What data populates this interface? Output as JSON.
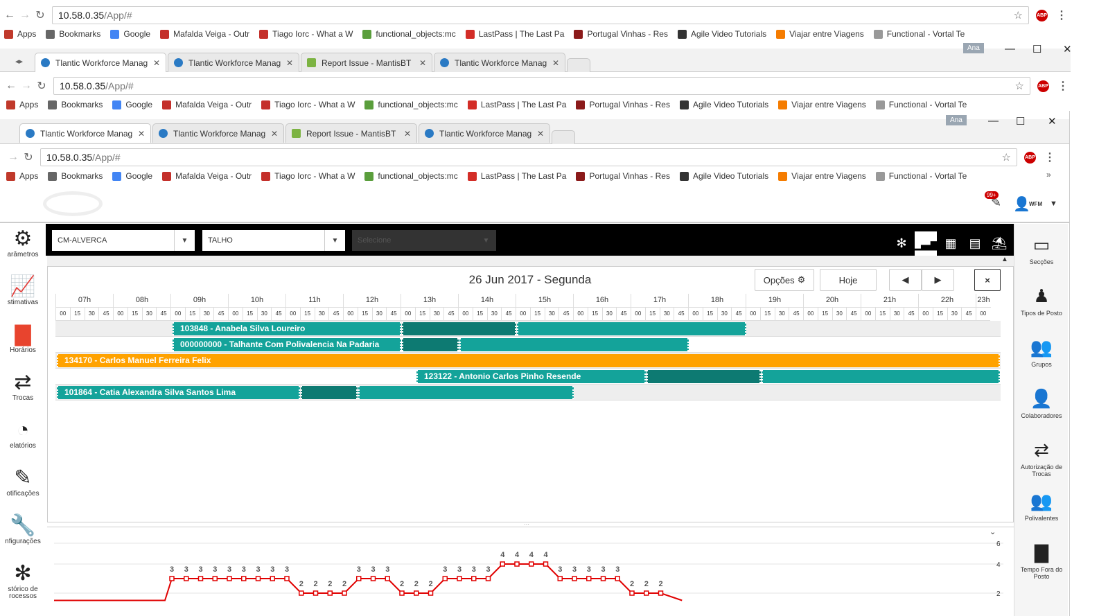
{
  "browser_back": {
    "url_host": "10.58.0.35",
    "url_path": "/App/#"
  },
  "browser_mid": {
    "url_host": "10.58.0.35",
    "url_path": "/App/#",
    "tabs": [
      "Tlantic Workforce Manag",
      "Tlantic Workforce Manag",
      "Report Issue - MantisBT",
      "Tlantic Workforce Manag"
    ],
    "user": "Ana"
  },
  "browser_front": {
    "url_host": "10.58.0.35",
    "url_path": "/App/#",
    "tabs": [
      "Tlantic Workforce Manag",
      "Tlantic Workforce Manag",
      "Report Issue - MantisBT",
      "Tlantic Workforce Manag"
    ],
    "user": "Ana"
  },
  "bookmarks": [
    "Apps",
    "Bookmarks",
    "Google",
    "Mafalda Veiga - Outr",
    "Tiago Iorc - What a W",
    "functional_objects:mc",
    "LastPass | The Last Pa",
    "Portugal Vinhas - Res",
    "Agile Video Tutorials",
    "Viajar entre Viagens",
    "Functional - Vortal Te"
  ],
  "abp_label": "ABP",
  "header": {
    "notif_badge": "99+",
    "user_name": "WFM"
  },
  "filters": {
    "store": "CM-ALVERCA",
    "section": "TALHO",
    "third_placeholder": "Selecione"
  },
  "left_nav": [
    {
      "label": "arâmetros",
      "icon": "gear-icon"
    },
    {
      "label": "stimativas",
      "icon": "trend-chart-icon"
    },
    {
      "label": "Horários",
      "icon": "bar-chart-icon"
    },
    {
      "label": "Trocas",
      "icon": "swap-icon"
    },
    {
      "label": "elatórios",
      "icon": "pie-chart-icon"
    },
    {
      "label": "otificações",
      "icon": "notification-icon"
    },
    {
      "label": "nfigurações",
      "icon": "wrench-icon"
    },
    {
      "label": "stórico de\nrocessos",
      "icon": "history-icon"
    }
  ],
  "right_nav": [
    {
      "label": "Secções",
      "icon": "sections-icon"
    },
    {
      "label": "Tipos de Posto",
      "icon": "chair-icon"
    },
    {
      "label": "Grupos",
      "icon": "group-icon"
    },
    {
      "label": "Colaboradores",
      "icon": "person-icon"
    },
    {
      "label": "Autorização de\nTrocas",
      "icon": "auth-swap-icon"
    },
    {
      "label": "Polivalentes",
      "icon": "multi-people-icon"
    },
    {
      "label": "Tempo Fora do\nPosto",
      "icon": "time-out-icon"
    }
  ],
  "schedule": {
    "date_title": "26 Jun 2017 - Segunda",
    "options_label": "Opções",
    "today_label": "Hoje",
    "close_label": "×",
    "hours": [
      "07h",
      "08h",
      "09h",
      "10h",
      "11h",
      "12h",
      "13h",
      "14h",
      "15h",
      "16h",
      "17h",
      "18h",
      "19h",
      "20h",
      "21h",
      "22h",
      "23h"
    ],
    "quarters": [
      "00",
      "15",
      "30",
      "45"
    ],
    "rows": [
      {
        "label": "103848 - Anabela Silva Loureiro"
      },
      {
        "label": "000000000 - Talhante Com Polivalencia Na Padaria"
      },
      {
        "label": "134170 - Carlos Manuel Ferreira Felix"
      },
      {
        "label": "123122 - Antonio Carlos Pinho Resende"
      },
      {
        "label": "101864 - Catia Alexandra Silva Santos Lima"
      }
    ]
  },
  "coverage_chart": {
    "y_ticks": [
      "6",
      "4",
      "2"
    ],
    "values_visible": [
      "3",
      "3",
      "3",
      "3",
      "3",
      "3",
      "3",
      "3",
      "3",
      "2",
      "2",
      "2",
      "2",
      "3",
      "3",
      "3",
      "2",
      "2",
      "2",
      "3",
      "3",
      "3",
      "3",
      "4",
      "4",
      "4",
      "4",
      "3",
      "3",
      "3",
      "3",
      "3",
      "2",
      "2",
      "2"
    ]
  },
  "chart_data": {
    "type": "line",
    "title": "",
    "series": [
      {
        "values": [
          3,
          3,
          3,
          3,
          3,
          3,
          3,
          3,
          3,
          2,
          2,
          2,
          2,
          3,
          3,
          3,
          2,
          2,
          2,
          3,
          3,
          3,
          3,
          4,
          4,
          4,
          4,
          3,
          3,
          3,
          3,
          3,
          2,
          2,
          2
        ]
      }
    ],
    "ylim": [
      0,
      6
    ],
    "color": "#e00000"
  }
}
